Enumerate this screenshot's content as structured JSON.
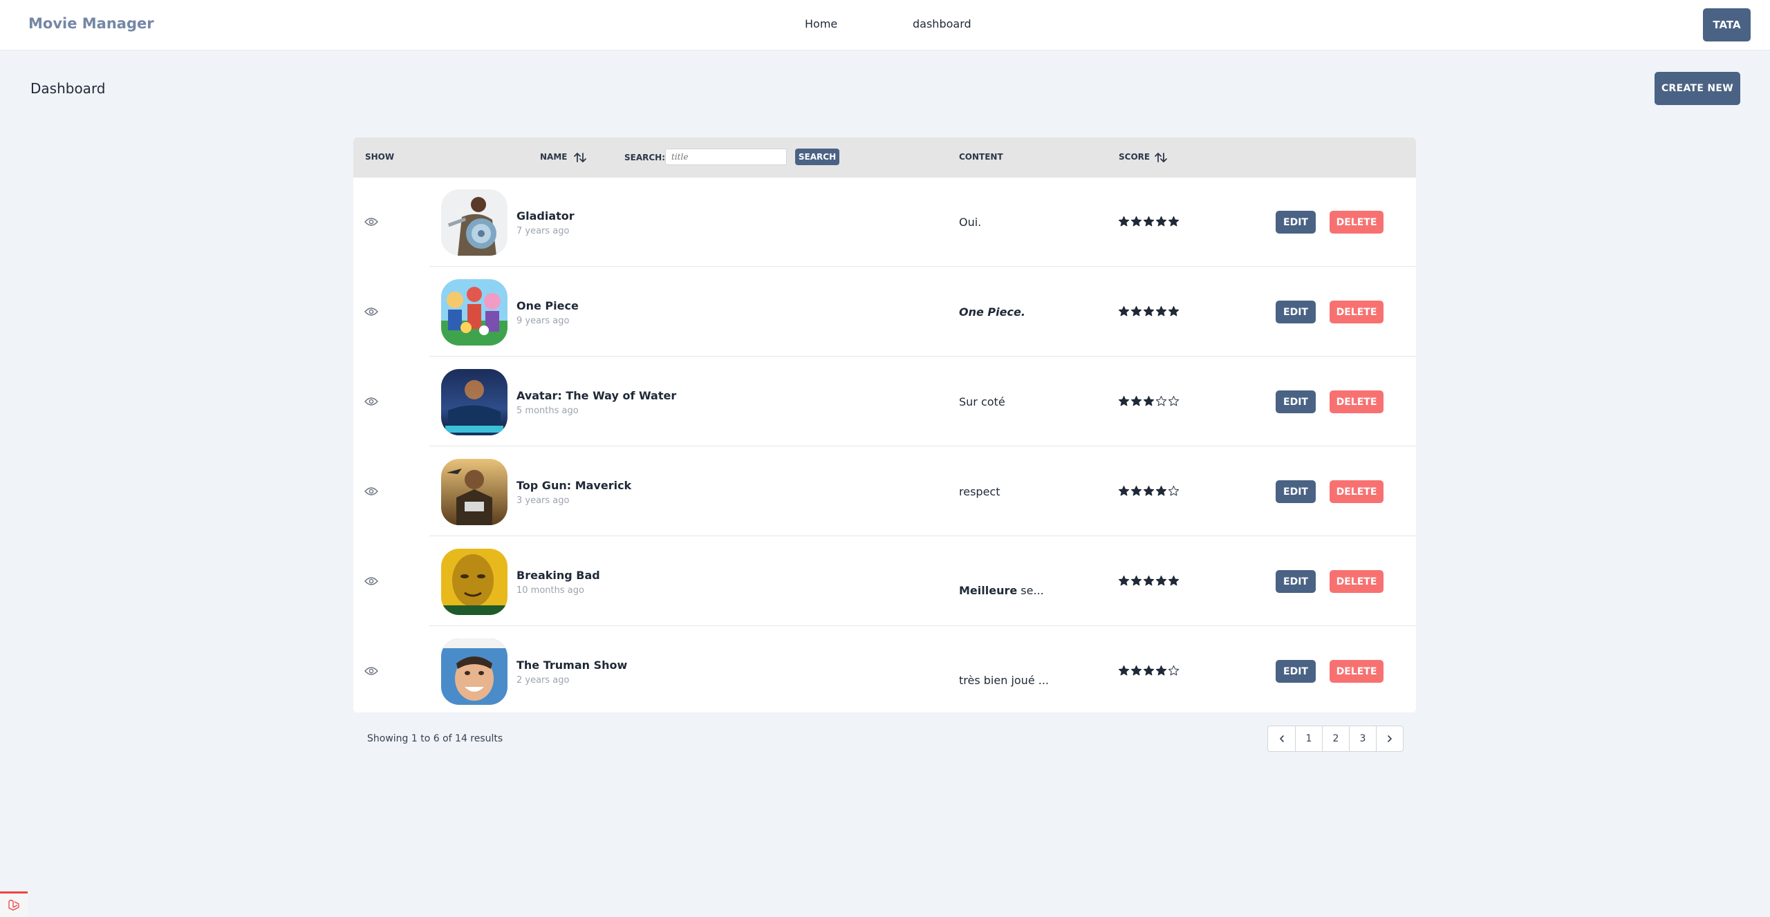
{
  "header": {
    "brand": "Movie Manager",
    "nav": [
      {
        "label": "Home"
      },
      {
        "label": "dashboard"
      }
    ],
    "user_label": "TATA"
  },
  "page": {
    "title": "Dashboard",
    "create_label": "CREATE NEW"
  },
  "table": {
    "columns": {
      "show": "SHOW",
      "name": "NAME",
      "content": "CONTENT",
      "score": "SCORE"
    },
    "search": {
      "label": "SEARCH:",
      "placeholder": "title",
      "button": "SEARCH"
    },
    "actions": {
      "edit": "EDIT",
      "delete": "DELETE"
    },
    "rows": [
      {
        "title": "Gladiator",
        "date": "7 years ago",
        "content_bold": "",
        "content_rest": "Oui.",
        "content_style": "normal",
        "score": 5,
        "poster": "gladiator"
      },
      {
        "title": "One Piece",
        "date": "9 years ago",
        "content_bold": "",
        "content_rest": "One Piece.",
        "content_style": "bold-italic",
        "score": 5,
        "poster": "onepiece"
      },
      {
        "title": "Avatar: The Way of Water",
        "date": "5 months ago",
        "content_bold": "",
        "content_rest": "Sur coté",
        "content_style": "normal",
        "score": 3,
        "poster": "avatar"
      },
      {
        "title": "Top Gun: Maverick",
        "date": "3 years ago",
        "content_bold": "",
        "content_rest": "respect",
        "content_style": "normal",
        "score": 4,
        "poster": "topgun"
      },
      {
        "title": "Breaking Bad",
        "date": "10 months ago",
        "content_bold": "Meilleure",
        "content_rest": " se...",
        "content_style": "mixed",
        "score": 5,
        "poster": "breakingbad"
      },
      {
        "title": "The Truman Show",
        "date": "2 years ago",
        "content_bold": "",
        "content_rest": "très bien joué ...",
        "content_style": "normal",
        "score": 4,
        "poster": "truman"
      }
    ],
    "max_score": 5
  },
  "pagination": {
    "summary": "Showing 1 to 6 of 14 results",
    "pages": [
      "1",
      "2",
      "3"
    ]
  },
  "icons": {
    "show": "eye-icon",
    "sort": "sort-arrows-icon",
    "prev": "chevron-left-icon",
    "next": "chevron-right-icon",
    "badge": "laravel-logo-icon"
  },
  "colors": {
    "primary": "#4a6284",
    "danger": "#f87171",
    "brand": "#7487a6",
    "background": "#f0f3f7"
  }
}
